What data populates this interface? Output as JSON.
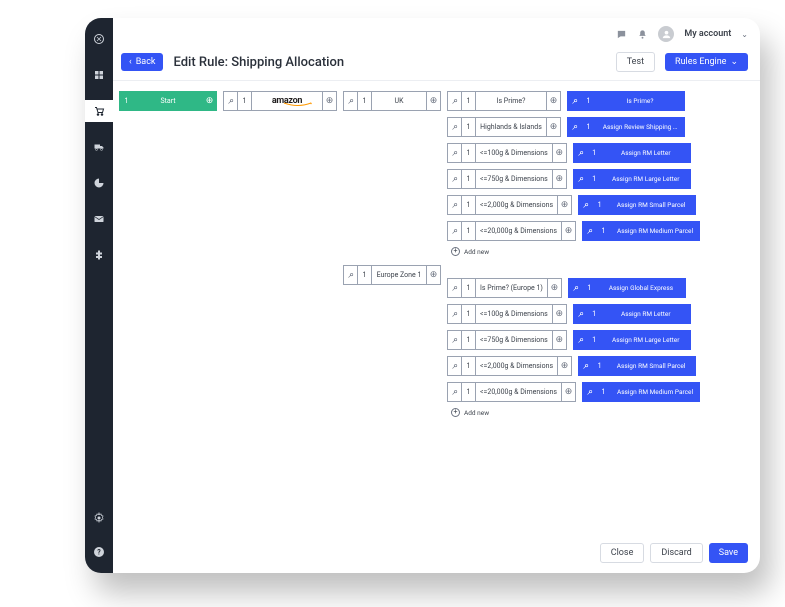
{
  "account": {
    "label": "My account"
  },
  "header": {
    "back": "Back",
    "title": "Edit Rule: Shipping Allocation",
    "test": "Test",
    "rules_engine": "Rules Engine"
  },
  "flow": {
    "start": "Start",
    "amazon": "amazon",
    "regions": [
      {
        "name": "UK",
        "conditions": [
          {
            "label": "Is Prime?",
            "action": "Is Prime?"
          },
          {
            "label": "Highlands & Islands",
            "action": "Assign Review Shipping …"
          },
          {
            "label": "<=100g & Dimensions",
            "action": "Assign RM Letter"
          },
          {
            "label": "<=750g & Dimensions",
            "action": "Assign RM Large Letter"
          },
          {
            "label": "<=2,000g & Dimensions",
            "action": "Assign RM Small Parcel"
          },
          {
            "label": "<=20,000g & Dimensions",
            "action": "Assign RM Medium Parcel"
          }
        ]
      },
      {
        "name": "Europe Zone 1",
        "conditions": [
          {
            "label": "Is Prime? (Europe 1)",
            "action": "Assign Global Express"
          },
          {
            "label": "<=100g & Dimensions",
            "action": "Assign RM Letter"
          },
          {
            "label": "<=750g & Dimensions",
            "action": "Assign RM Large Letter"
          },
          {
            "label": "<=2,000g & Dimensions",
            "action": "Assign RM Small Parcel"
          },
          {
            "label": "<=20,000g & Dimensions",
            "action": "Assign RM Medium Parcel"
          }
        ]
      }
    ],
    "addnew": "Add new"
  },
  "footer": {
    "close": "Close",
    "discard": "Discard",
    "save": "Save"
  }
}
